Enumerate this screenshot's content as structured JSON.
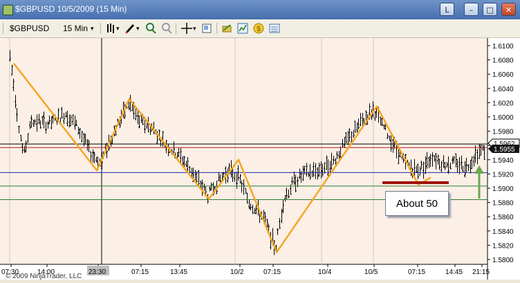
{
  "window": {
    "title": "$GBPUSD  10/5/2009 (15 Min)",
    "link_button": "L",
    "minimize": "–",
    "maximize": "□",
    "close": "✕"
  },
  "toolbar": {
    "instrument": "$GBPUSD",
    "interval": "15 Min",
    "dropdown_arrow": "▾"
  },
  "chart": {
    "copyright": "© 2009 NinjaTrader, LLC",
    "annotation": "About 50",
    "price_labels": [
      "1.6100",
      "1.6080",
      "1.6060",
      "1.6040",
      "1.6020",
      "1.6000",
      "1.5980",
      "1.5960",
      "1.5940",
      "1.5920",
      "1.5900",
      "1.5880",
      "1.5860",
      "1.5840",
      "1.5820",
      "1.5800"
    ],
    "price_label_values": [
      1.61,
      1.608,
      1.606,
      1.604,
      1.602,
      1.6,
      1.598,
      1.596,
      1.594,
      1.592,
      1.59,
      1.588,
      1.586,
      1.584,
      1.582,
      1.58
    ],
    "current_price_label": "1.5962",
    "last_price_label": "1.5955",
    "time_labels": [
      "07:30",
      "14:00",
      "23:30",
      "07:15",
      "13:45",
      "10/2",
      "07:15",
      "10/4",
      "10/5",
      "07:15",
      "14:45",
      "21:15"
    ],
    "colors": {
      "background": "#fbefe6",
      "bars": "#000000",
      "zigzag": "#f5a623",
      "red_line": "#b22222",
      "blue_line": "#1b2aa8",
      "green_line": "#2e7d32",
      "arrow": "#6aa84f",
      "support_bar": "#a0120c"
    }
  }
}
